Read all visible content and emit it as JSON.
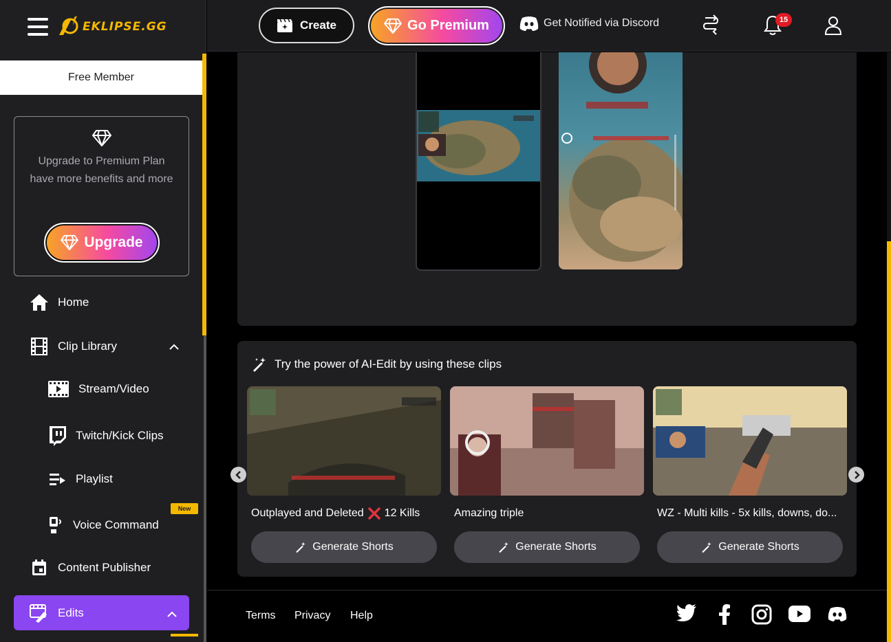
{
  "brand": {
    "name": "EKLIPSE.GG",
    "accent": "#f5b800"
  },
  "sidebar": {
    "membership": "Free Member",
    "upgrade_card": {
      "text": "Upgrade to Premium Plan have more benefits and more",
      "button_label": "Upgrade"
    },
    "items": [
      {
        "label": "Home",
        "icon": "home-icon"
      },
      {
        "label": "Clip Library",
        "icon": "film-icon",
        "expanded": true
      },
      {
        "label": "Stream/Video",
        "icon": "video-icon"
      },
      {
        "label": "Twitch/Kick Clips",
        "icon": "twitch-icon"
      },
      {
        "label": "Playlist",
        "icon": "playlist-icon"
      },
      {
        "label": "Voice Command",
        "icon": "voice-command-icon",
        "badge": "New"
      },
      {
        "label": "Content Publisher",
        "icon": "calendar-icon"
      },
      {
        "label": "Edits",
        "icon": "edit-film-icon",
        "active": true,
        "expanded": true
      }
    ]
  },
  "header": {
    "create_label": "Create",
    "premium_label": "Go Premium",
    "discord_label": "Get Notified via Discord",
    "notification_count": "15"
  },
  "ai_edit": {
    "title": "Try the power of AI-Edit by using these clips",
    "clips": [
      {
        "title": "Outplayed and Deleted",
        "suffix": "12 Kills",
        "button": "Generate Shorts"
      },
      {
        "title": "Amazing triple",
        "suffix": "",
        "button": "Generate Shorts"
      },
      {
        "title": "WZ - Multi kills - 5x kills, downs, do...",
        "suffix": "",
        "button": "Generate Shorts"
      }
    ]
  },
  "footer": {
    "links": [
      "Terms",
      "Privacy",
      "Help"
    ],
    "social": [
      "twitter-icon",
      "facebook-icon",
      "instagram-icon",
      "youtube-icon",
      "discord-icon"
    ]
  }
}
